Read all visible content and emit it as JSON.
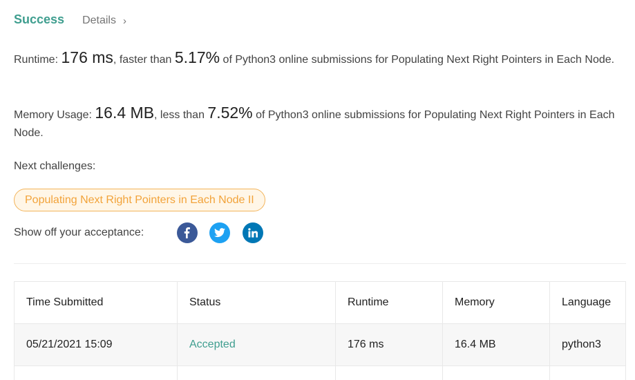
{
  "header": {
    "status": "Success",
    "details_label": "Details"
  },
  "runtime": {
    "label": "Runtime:",
    "value": "176 ms",
    "mid": ", faster than",
    "percent": "5.17%",
    "suffix": "of Python3 online submissions for Populating Next Right Pointers in Each Node."
  },
  "memory": {
    "label": "Memory Usage:",
    "value": "16.4 MB",
    "mid": ", less than",
    "percent": "7.52%",
    "suffix": "of Python3 online submissions for Populating Next Right Pointers in Each Node."
  },
  "next": {
    "label": "Next challenges:",
    "challenge": "Populating Next Right Pointers in Each Node II"
  },
  "share": {
    "label": "Show off your acceptance:"
  },
  "table": {
    "headers": [
      "Time Submitted",
      "Status",
      "Runtime",
      "Memory",
      "Language"
    ],
    "rows": [
      [
        "05/21/2021 15:09",
        "Accepted",
        "176 ms",
        "16.4 MB",
        "python3"
      ]
    ]
  },
  "colors": {
    "accent": "#3f9e8f",
    "chip_text": "#f2a33a",
    "chip_border": "#f3b45b",
    "facebook": "#3b5998",
    "twitter": "#1da1f2",
    "linkedin": "#0077b5"
  }
}
